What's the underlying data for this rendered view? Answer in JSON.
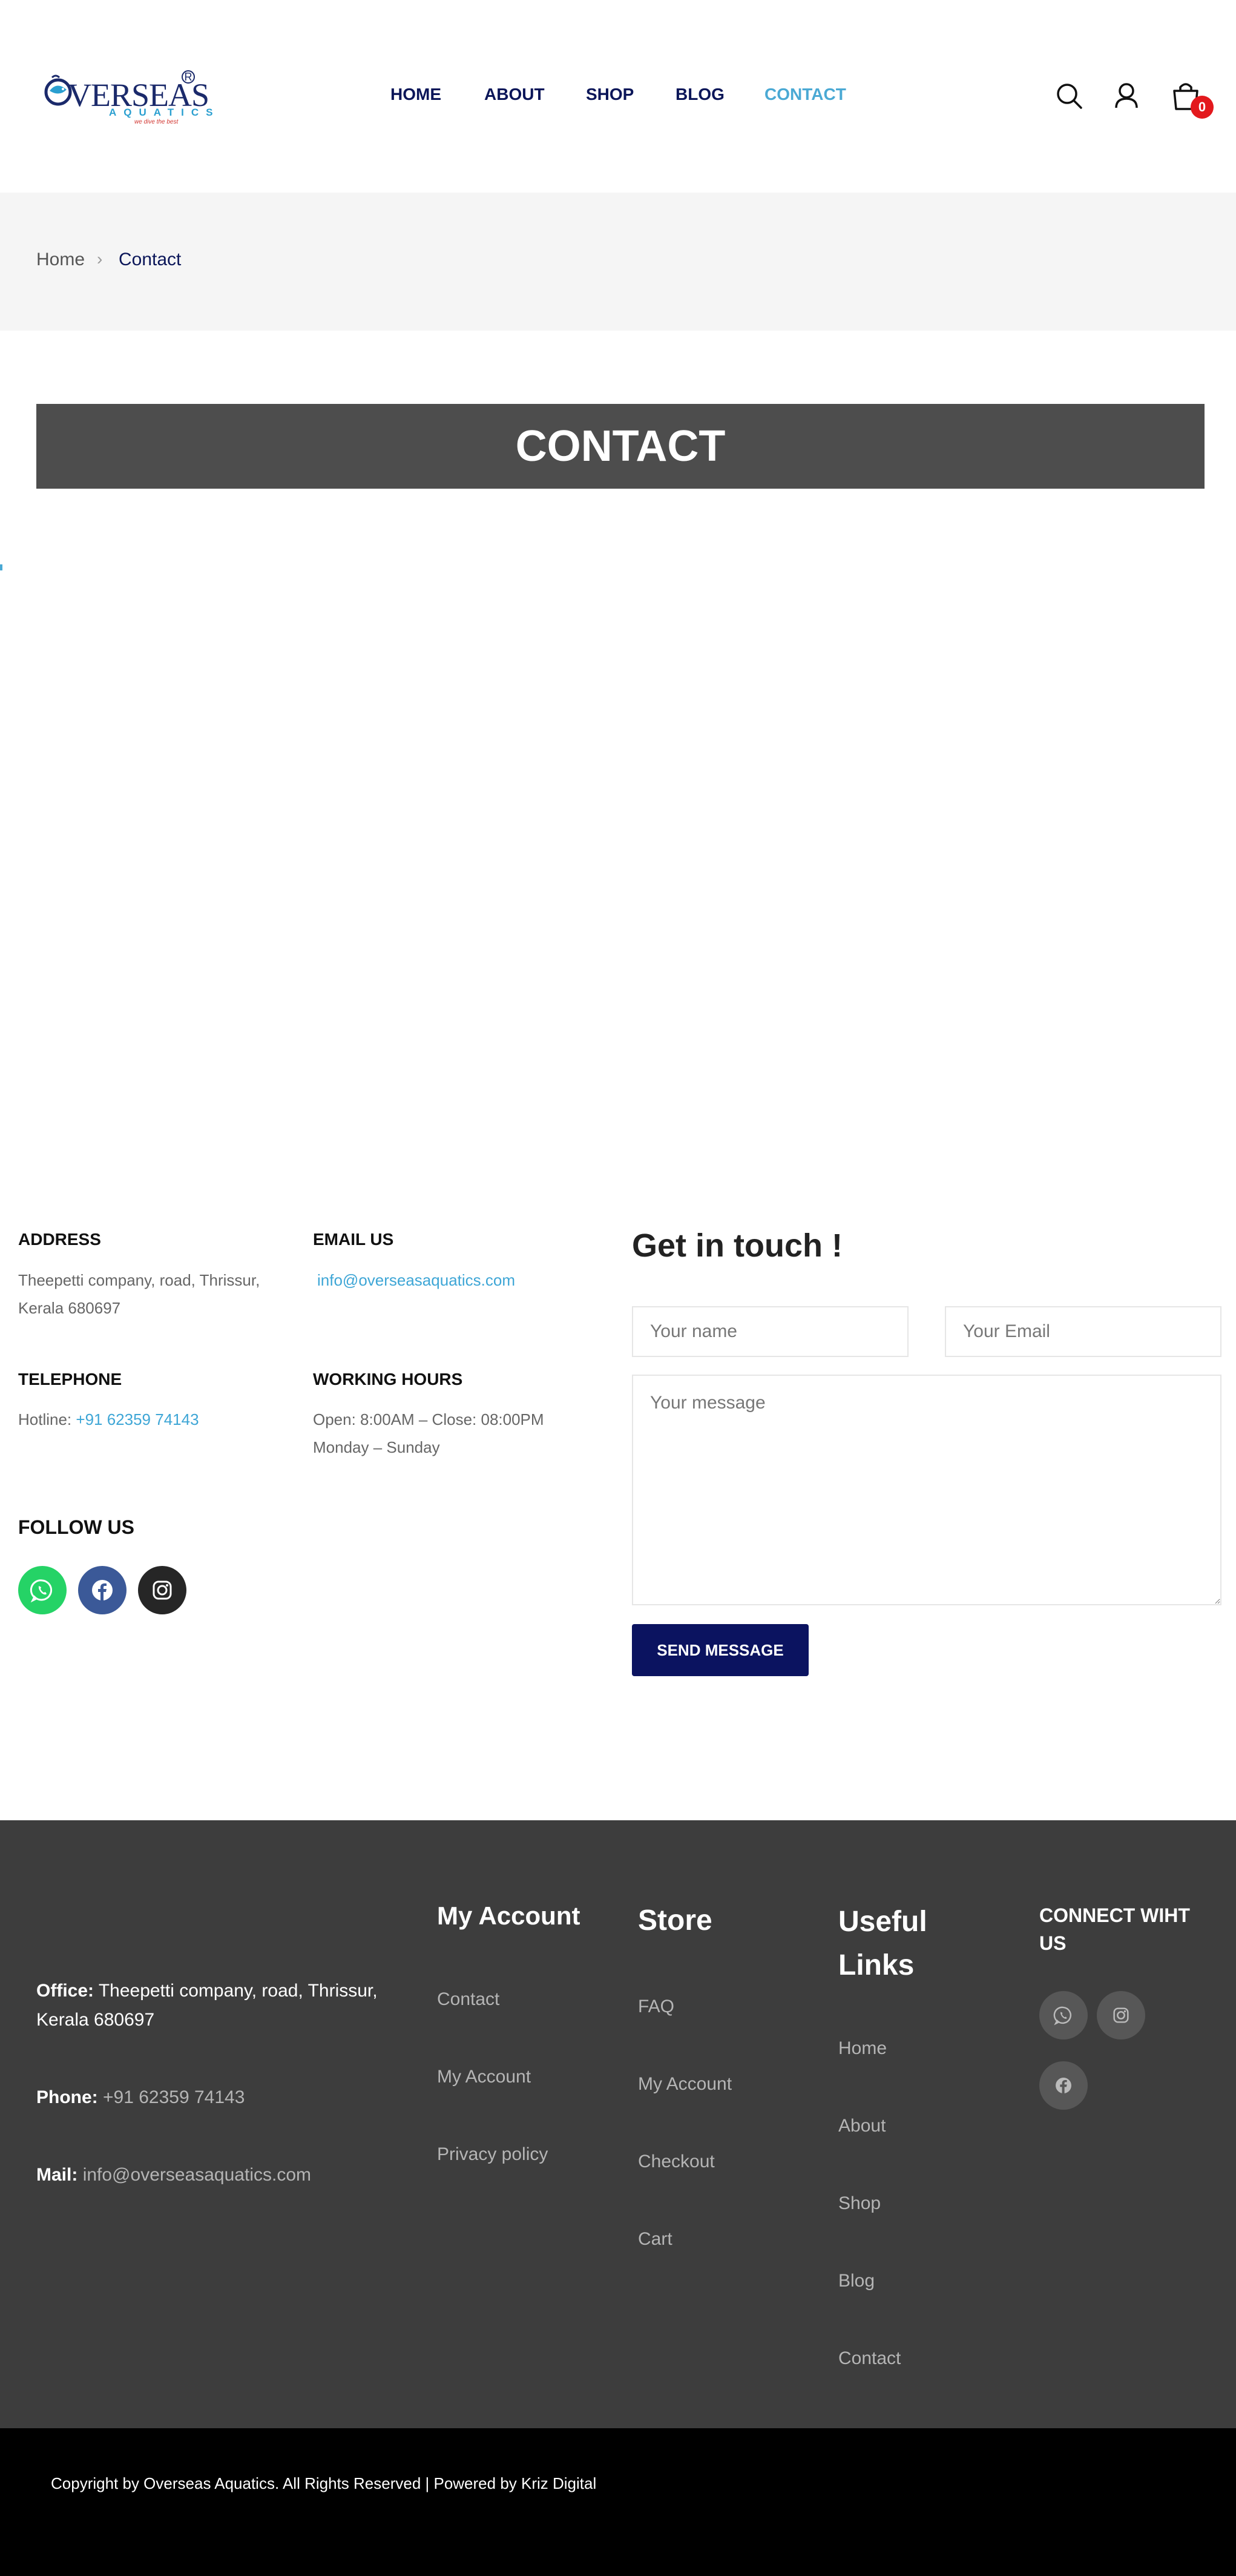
{
  "header": {
    "logo": {
      "word": "VERSEAS",
      "sub": "AQUATICS",
      "tag": "we dive the best",
      "reg": "R"
    },
    "nav": [
      "HOME",
      "ABOUT",
      "SHOP",
      "BLOG",
      "CONTACT"
    ],
    "active_nav": "CONTACT",
    "cart_count": "0",
    "accent_color": "#4aa9d4",
    "nav_color": "#0b1659",
    "icons": [
      "search-icon",
      "user-icon",
      "bag-icon"
    ]
  },
  "breadcrumb": {
    "home": "Home",
    "separator": "›",
    "current": "Contact"
  },
  "page_title": "CONTACT",
  "contact_info": {
    "address_heading": "ADDRESS",
    "address_line1": "Theepetti company, road, Thrissur,",
    "address_line2": "Kerala 680697",
    "email_heading": "EMAIL US",
    "email": "info@overseasaquatics.com",
    "telephone_heading": "TELEPHONE",
    "hotline_label": "Hotline:",
    "hotline": "+91 62359 74143",
    "hours_heading": "WORKING HOURS",
    "hours_line1": "Open: 8:00AM – Close: 08:00PM",
    "hours_line2": "Monday – Sunday",
    "follow_heading": "FOLLOW US",
    "social": [
      {
        "icon": "whatsapp-icon",
        "color": "#25d366"
      },
      {
        "icon": "facebook-icon",
        "color": "#3b5998"
      },
      {
        "icon": "instagram-icon",
        "color": "#262626"
      }
    ]
  },
  "form": {
    "title": "Get in touch !",
    "name_placeholder": "Your name",
    "email_placeholder": "Your Email",
    "message_placeholder": "Your message",
    "submit_label": "SEND MESSAGE",
    "button_color": "#0b1360"
  },
  "footer": {
    "office_label": "Office:",
    "office_line1": "Theepetti company, road, Thrissur,",
    "office_line2": "Kerala 680697",
    "phone_label": "Phone:",
    "phone": "+91 62359 74143",
    "mail_label": "Mail:",
    "mail": "info@overseasaquatics.com",
    "my_account": {
      "heading": "My Account",
      "links": [
        "Contact",
        "My Account",
        "Privacy policy"
      ]
    },
    "store": {
      "heading": "Store",
      "links": [
        "FAQ",
        "My Account",
        "Checkout",
        "Cart"
      ]
    },
    "useful": {
      "heading_line1": "Useful",
      "heading_line2": "Links",
      "links": [
        "Home",
        "About",
        "Shop",
        "Blog",
        "Contact"
      ]
    },
    "connect": {
      "heading_line1": "CONNECT WIHT",
      "heading_line2": "US",
      "icons": [
        "whatsapp-icon",
        "instagram-icon",
        "facebook-icon"
      ]
    },
    "background": "#3d3d3d"
  },
  "copyright": "Copyright by Overseas Aquatics. All Rights Reserved | Powered by Kriz Digital"
}
